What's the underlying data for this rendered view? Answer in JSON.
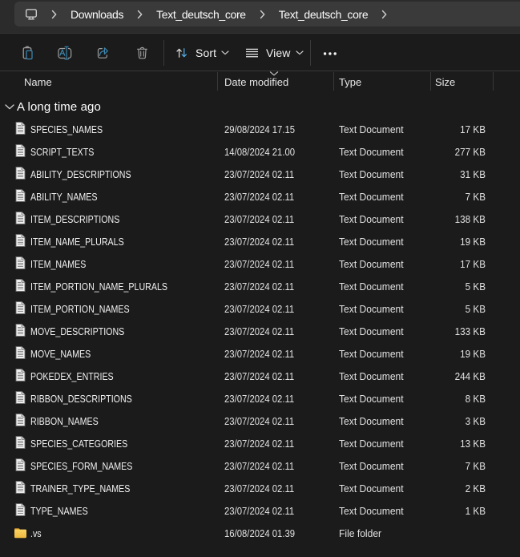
{
  "breadcrumb": {
    "root_icon": "this-pc",
    "segments": [
      "Downloads",
      "Text_deutsch_core",
      "Text_deutsch_core"
    ]
  },
  "toolbar": {
    "buttons": [
      {
        "icon": "paste-icon",
        "label": ""
      },
      {
        "icon": "rename-icon",
        "label": ""
      },
      {
        "icon": "share-icon",
        "label": ""
      },
      {
        "icon": "delete-icon",
        "label": ""
      }
    ],
    "sort_label": "Sort",
    "view_label": "View",
    "more_icon": "see-more-ellipsis"
  },
  "columns": {
    "name": "Name",
    "date": "Date modified",
    "type": "Type",
    "size": "Size",
    "sorted_by": "Date modified"
  },
  "group": {
    "label": "A long time ago"
  },
  "files": {
    "rows": [
      {
        "name": "SPECIES_NAMES",
        "date": "29/08/2024 17.15",
        "type": "Text Document",
        "size": "17 KB",
        "icon": "text-file-icon"
      },
      {
        "name": "SCRIPT_TEXTS",
        "date": "14/08/2024 21.00",
        "type": "Text Document",
        "size": "277 KB",
        "icon": "text-file-icon"
      },
      {
        "name": "ABILITY_DESCRIPTIONS",
        "date": "23/07/2024 02.11",
        "type": "Text Document",
        "size": "31 KB",
        "icon": "text-file-icon"
      },
      {
        "name": "ABILITY_NAMES",
        "date": "23/07/2024 02.11",
        "type": "Text Document",
        "size": "7 KB",
        "icon": "text-file-icon"
      },
      {
        "name": "ITEM_DESCRIPTIONS",
        "date": "23/07/2024 02.11",
        "type": "Text Document",
        "size": "138 KB",
        "icon": "text-file-icon"
      },
      {
        "name": "ITEM_NAME_PLURALS",
        "date": "23/07/2024 02.11",
        "type": "Text Document",
        "size": "19 KB",
        "icon": "text-file-icon"
      },
      {
        "name": "ITEM_NAMES",
        "date": "23/07/2024 02.11",
        "type": "Text Document",
        "size": "17 KB",
        "icon": "text-file-icon"
      },
      {
        "name": "ITEM_PORTION_NAME_PLURALS",
        "date": "23/07/2024 02.11",
        "type": "Text Document",
        "size": "5 KB",
        "icon": "text-file-icon"
      },
      {
        "name": "ITEM_PORTION_NAMES",
        "date": "23/07/2024 02.11",
        "type": "Text Document",
        "size": "5 KB",
        "icon": "text-file-icon"
      },
      {
        "name": "MOVE_DESCRIPTIONS",
        "date": "23/07/2024 02.11",
        "type": "Text Document",
        "size": "133 KB",
        "icon": "text-file-icon"
      },
      {
        "name": "MOVE_NAMES",
        "date": "23/07/2024 02.11",
        "type": "Text Document",
        "size": "19 KB",
        "icon": "text-file-icon"
      },
      {
        "name": "POKEDEX_ENTRIES",
        "date": "23/07/2024 02.11",
        "type": "Text Document",
        "size": "244 KB",
        "icon": "text-file-icon"
      },
      {
        "name": "RIBBON_DESCRIPTIONS",
        "date": "23/07/2024 02.11",
        "type": "Text Document",
        "size": "8 KB",
        "icon": "text-file-icon"
      },
      {
        "name": "RIBBON_NAMES",
        "date": "23/07/2024 02.11",
        "type": "Text Document",
        "size": "3 KB",
        "icon": "text-file-icon"
      },
      {
        "name": "SPECIES_CATEGORIES",
        "date": "23/07/2024 02.11",
        "type": "Text Document",
        "size": "13 KB",
        "icon": "text-file-icon"
      },
      {
        "name": "SPECIES_FORM_NAMES",
        "date": "23/07/2024 02.11",
        "type": "Text Document",
        "size": "7 KB",
        "icon": "text-file-icon"
      },
      {
        "name": "TRAINER_TYPE_NAMES",
        "date": "23/07/2024 02.11",
        "type": "Text Document",
        "size": "2 KB",
        "icon": "text-file-icon"
      },
      {
        "name": "TYPE_NAMES",
        "date": "23/07/2024 02.11",
        "type": "Text Document",
        "size": "1 KB",
        "icon": "text-file-icon"
      },
      {
        "name": ".vs",
        "date": "16/08/2024 01.39",
        "type": "File folder",
        "size": "",
        "icon": "folder-icon"
      }
    ]
  },
  "colors": {
    "accent_blue": "#3b87b0",
    "sort_arrow_blue": "#54a8dd",
    "folder_yellow_top": "#fcd464",
    "folder_yellow_bottom": "#edb93e",
    "folder_tab": "#d99c27",
    "window_bg": "#1b1b1b",
    "address_row_bg": "#2b2b2b",
    "address_bar_bg": "#3a3a3a"
  }
}
